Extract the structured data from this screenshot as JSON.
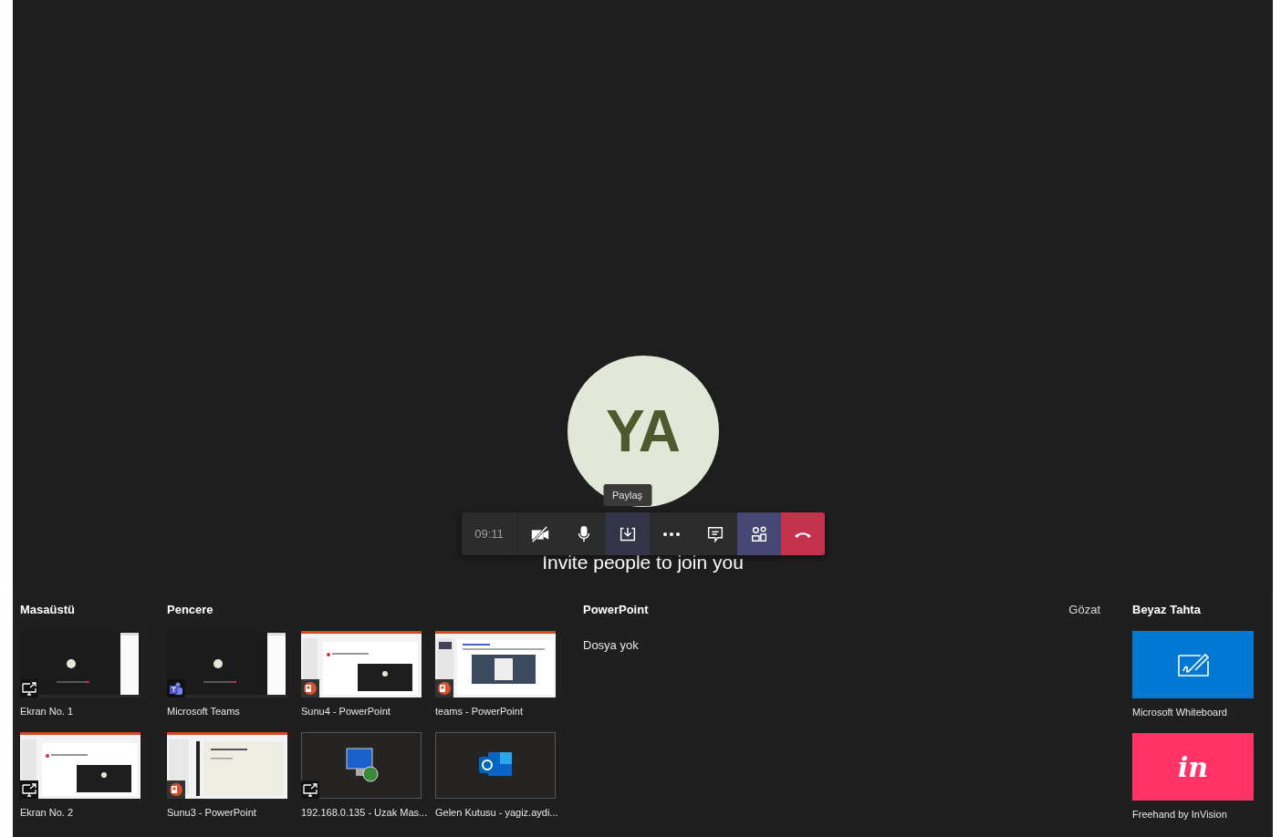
{
  "call": {
    "avatar_initials": "YA",
    "invite_text": "Invite people to join you"
  },
  "controls": {
    "timer": "09:11",
    "buttons": [
      {
        "kind": "camera-off",
        "selected": false,
        "hovered": false
      },
      {
        "kind": "mic",
        "selected": false,
        "hovered": false
      },
      {
        "kind": "share",
        "selected": false,
        "hovered": true,
        "tooltip": "Paylaş"
      },
      {
        "kind": "more",
        "selected": false,
        "hovered": false
      },
      {
        "kind": "chat",
        "selected": false,
        "hovered": false
      },
      {
        "kind": "people",
        "selected": true,
        "hovered": false
      },
      {
        "kind": "hang-up"
      }
    ]
  },
  "share_tray": {
    "desktop": {
      "title": "Masaüstü",
      "items": [
        {
          "label": "Ekran No. 1",
          "kind": "meeting",
          "badge": {
            "kind": "screen"
          }
        },
        {
          "label": "Ekran No. 2",
          "kind": "slides",
          "badge": {
            "kind": "screen"
          }
        }
      ]
    },
    "window": {
      "title": "Pencere",
      "items": [
        {
          "label": "Microsoft Teams",
          "kind": "meeting",
          "badge": {
            "kind": "teams"
          }
        },
        {
          "label": "Sunu4 - PowerPoint",
          "kind": "slides",
          "badge": {
            "kind": "powerpoint"
          }
        },
        {
          "label": "teams - PowerPoint",
          "kind": "document",
          "badge": {
            "kind": "powerpoint"
          }
        },
        {
          "label": "Sunu3 - PowerPoint",
          "kind": "blank-slide",
          "badge": {
            "kind": "powerpoint"
          }
        },
        {
          "label": "192.168.0.135 - Uzak Mas...",
          "kind": "remote",
          "badge": {
            "kind": "screen"
          }
        },
        {
          "label": "Gelen Kutusu - yagiz.aydi...",
          "kind": "mail"
        }
      ]
    },
    "powerpoint": {
      "title": "PowerPoint",
      "empty_text": "Dosya yok",
      "browse": "Gözat"
    },
    "whiteboard": {
      "title": "Beyaz Tahta",
      "items": [
        {
          "label": "Microsoft Whiteboard",
          "kind": "whiteboard",
          "color": "#0078d4"
        },
        {
          "label": "Freehand by InVision",
          "kind": "invision",
          "color": "#ff3366",
          "logo_text": "in"
        }
      ]
    }
  }
}
